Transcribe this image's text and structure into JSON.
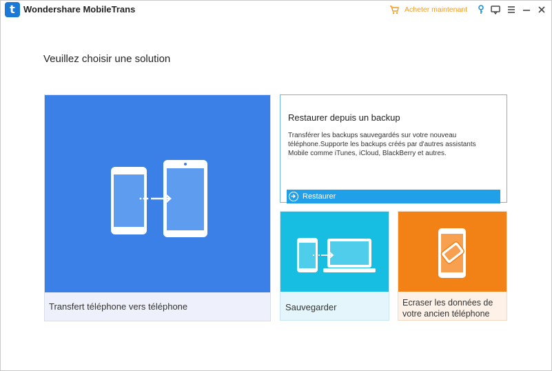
{
  "app": {
    "logo_letter": "t",
    "title": "Wondershare MobileTrans"
  },
  "toolbar": {
    "buy_label": "Acheter maintenant",
    "icons": [
      "cart-icon",
      "key-icon",
      "feedback-icon",
      "menu-icon",
      "minimize-icon",
      "close-icon"
    ],
    "accent": "#f39a1e"
  },
  "main": {
    "heading": "Veuillez choisir une solution"
  },
  "cards": {
    "transfer": {
      "label": "Transfert téléphone vers téléphone",
      "color": "#3a80e6"
    },
    "restore": {
      "title": "Restaurer depuis un backup",
      "description": "Transférer les backups sauvegardés sur votre nouveau téléphone.Supporte les backups créés par d'autres assistants Mobile comme iTunes, iCloud, BlackBerry et autres.",
      "button_label": "Restaurer",
      "color": "#20a0e8"
    },
    "backup": {
      "label": "Sauvegarder",
      "color": "#18bde2"
    },
    "erase": {
      "label": "Ecraser les données de votre ancien téléphone",
      "color": "#f28215"
    }
  }
}
